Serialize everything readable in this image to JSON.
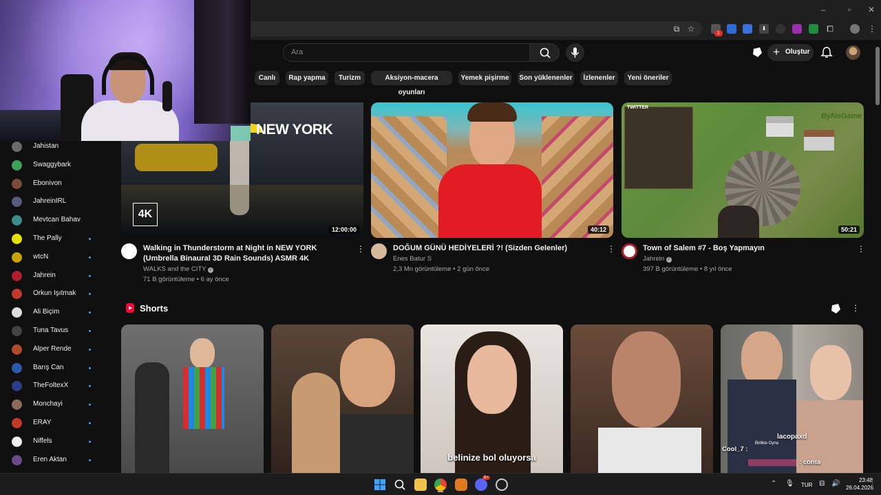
{
  "search": {
    "placeholder": "Ara"
  },
  "header": {
    "create_label": "Oluştur"
  },
  "chips": [
    "Canlı",
    "Rap yapma",
    "Turizm",
    "Aksiyon-macera oyunları",
    "Yemek pişirme",
    "Son yüklenenler",
    "İzlenenler",
    "Yeni öneriler"
  ],
  "subscriptions": [
    {
      "name": "Jahistan",
      "live": false,
      "color": "#6b6b6b"
    },
    {
      "name": "Swaggybark",
      "live": false,
      "color": "#3aa35a"
    },
    {
      "name": "Ebonivon",
      "live": false,
      "color": "#7b4b3a"
    },
    {
      "name": "JahreinIRL",
      "live": false,
      "color": "#5a5a7a"
    },
    {
      "name": "Mevtcan Bahav",
      "live": false,
      "color": "#3c8c8c"
    },
    {
      "name": "The Pally",
      "live": true,
      "color": "#e6e000"
    },
    {
      "name": "wtcN",
      "live": true,
      "color": "#c8a200"
    },
    {
      "name": "Jahrein",
      "live": true,
      "color": "#b01e2e"
    },
    {
      "name": "Orkun Işıtmak",
      "live": true,
      "color": "#c0392b"
    },
    {
      "name": "Ali Biçim",
      "live": true,
      "color": "#dddddd"
    },
    {
      "name": "Tuna Tavus",
      "live": true,
      "color": "#444444"
    },
    {
      "name": "Alper Rende",
      "live": true,
      "color": "#b04a2a"
    },
    {
      "name": "Barış Can",
      "live": true,
      "color": "#2d5aa8"
    },
    {
      "name": "TheFoltexX",
      "live": true,
      "color": "#2b3e8c"
    },
    {
      "name": "Monchayi",
      "live": true,
      "color": "#8c6b5a"
    },
    {
      "name": "ERAY",
      "live": true,
      "color": "#c0392b"
    },
    {
      "name": "Niffels",
      "live": true,
      "color": "#eeeeee"
    },
    {
      "name": "Eren Aktan",
      "live": true,
      "color": "#6a4a8c"
    }
  ],
  "videos": [
    {
      "title": "Walking in Thunderstorm at Night in NEW YORK (Umbrella Binaural 3D Rain Sounds) ASMR 4K",
      "channel": "WALKS and the CITY",
      "meta": "71 B görüntüleme • 6 ay önce",
      "duration": "12:00:00",
      "thumb_text": "NEW YORK",
      "badge": "4K"
    },
    {
      "title": "DOĞUM GÜNÜ HEDİYELERİ ?! (Sizden Gelenler)",
      "channel": "Enes Batur S",
      "meta": "2,3 Mn görüntüleme • 2 gün önce",
      "duration": "40:12"
    },
    {
      "title": "Town of Salem #7 - Boş Yapmayın",
      "channel": "Jahrein",
      "meta": "397 B görüntüleme • 8 yıl önce",
      "duration": "50:21",
      "thumb_text": "ByNoGame",
      "thumb_badge": "TWITTER"
    }
  ],
  "shorts": {
    "title": "Shorts",
    "captions": [
      "belinize bol oluyorsa",
      "lacopaxd",
      "Cool_7 :",
      "Birlikte Oyna",
      ": conta"
    ]
  },
  "taskbar": {
    "lang": "TUR",
    "time": "23:48",
    "date": "26.04.2026",
    "discord_badge": "9+"
  },
  "colors": {
    "background": "#0f0f0f",
    "accent_red": "#ff0033",
    "link_blue": "#3ea6ff"
  }
}
